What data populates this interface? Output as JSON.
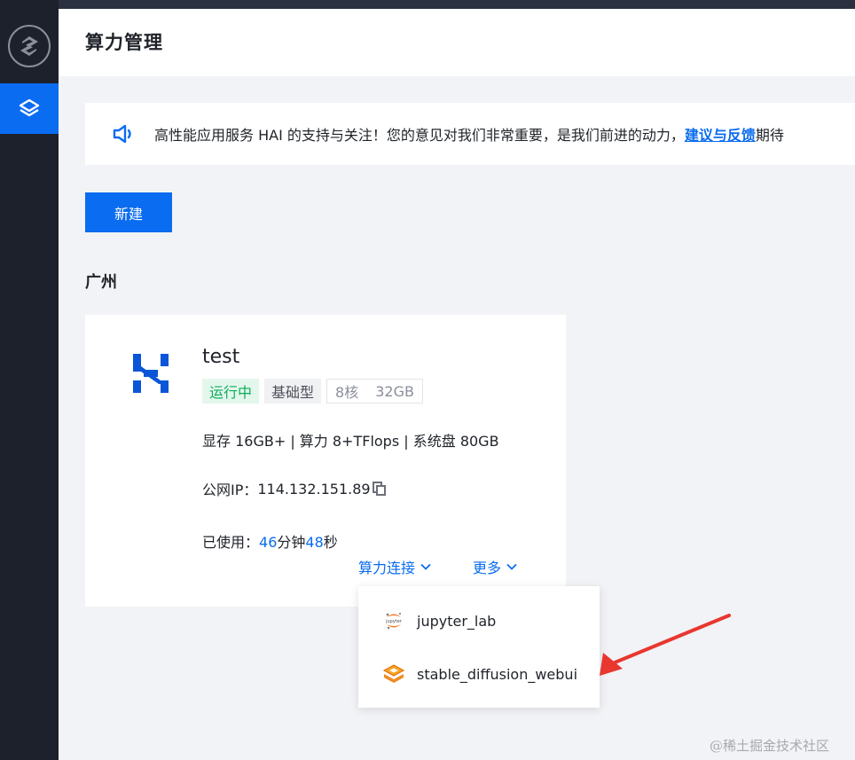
{
  "page": {
    "title": "算力管理",
    "brand_color": "#0a6cf0"
  },
  "notice": {
    "text": "高性能应用服务 HAI 的支持与关注！您的意见对我们非常重要，是我们前进的动力，",
    "link": "建议与反馈",
    "tail": "期待"
  },
  "toolbar": {
    "new_label": "新建"
  },
  "region": "广州",
  "instance": {
    "name": "test",
    "status": "运行中",
    "type": "基础型",
    "cpu": "8核",
    "memory": "32GB",
    "spec": "显存 16GB+ | 算力 8+TFlops | 系统盘 80GB",
    "ip_label": "公网IP：",
    "ip": "114.132.151.89",
    "used_label": "已使用：",
    "used_minutes": "46",
    "minutes_unit": "分钟",
    "used_seconds": "48",
    "seconds_unit": "秒",
    "connect_label": "算力连接",
    "more_label": "更多"
  },
  "dropdown": {
    "items": [
      {
        "label": "jupyter_lab",
        "icon": "jupyter-icon"
      },
      {
        "label": "stable_diffusion_webui",
        "icon": "stable-diffusion-icon"
      }
    ]
  },
  "watermark": "@稀土掘金技术社区",
  "colors": {
    "status_green": "#0cae5c",
    "annotation_red": "#e8372f"
  }
}
